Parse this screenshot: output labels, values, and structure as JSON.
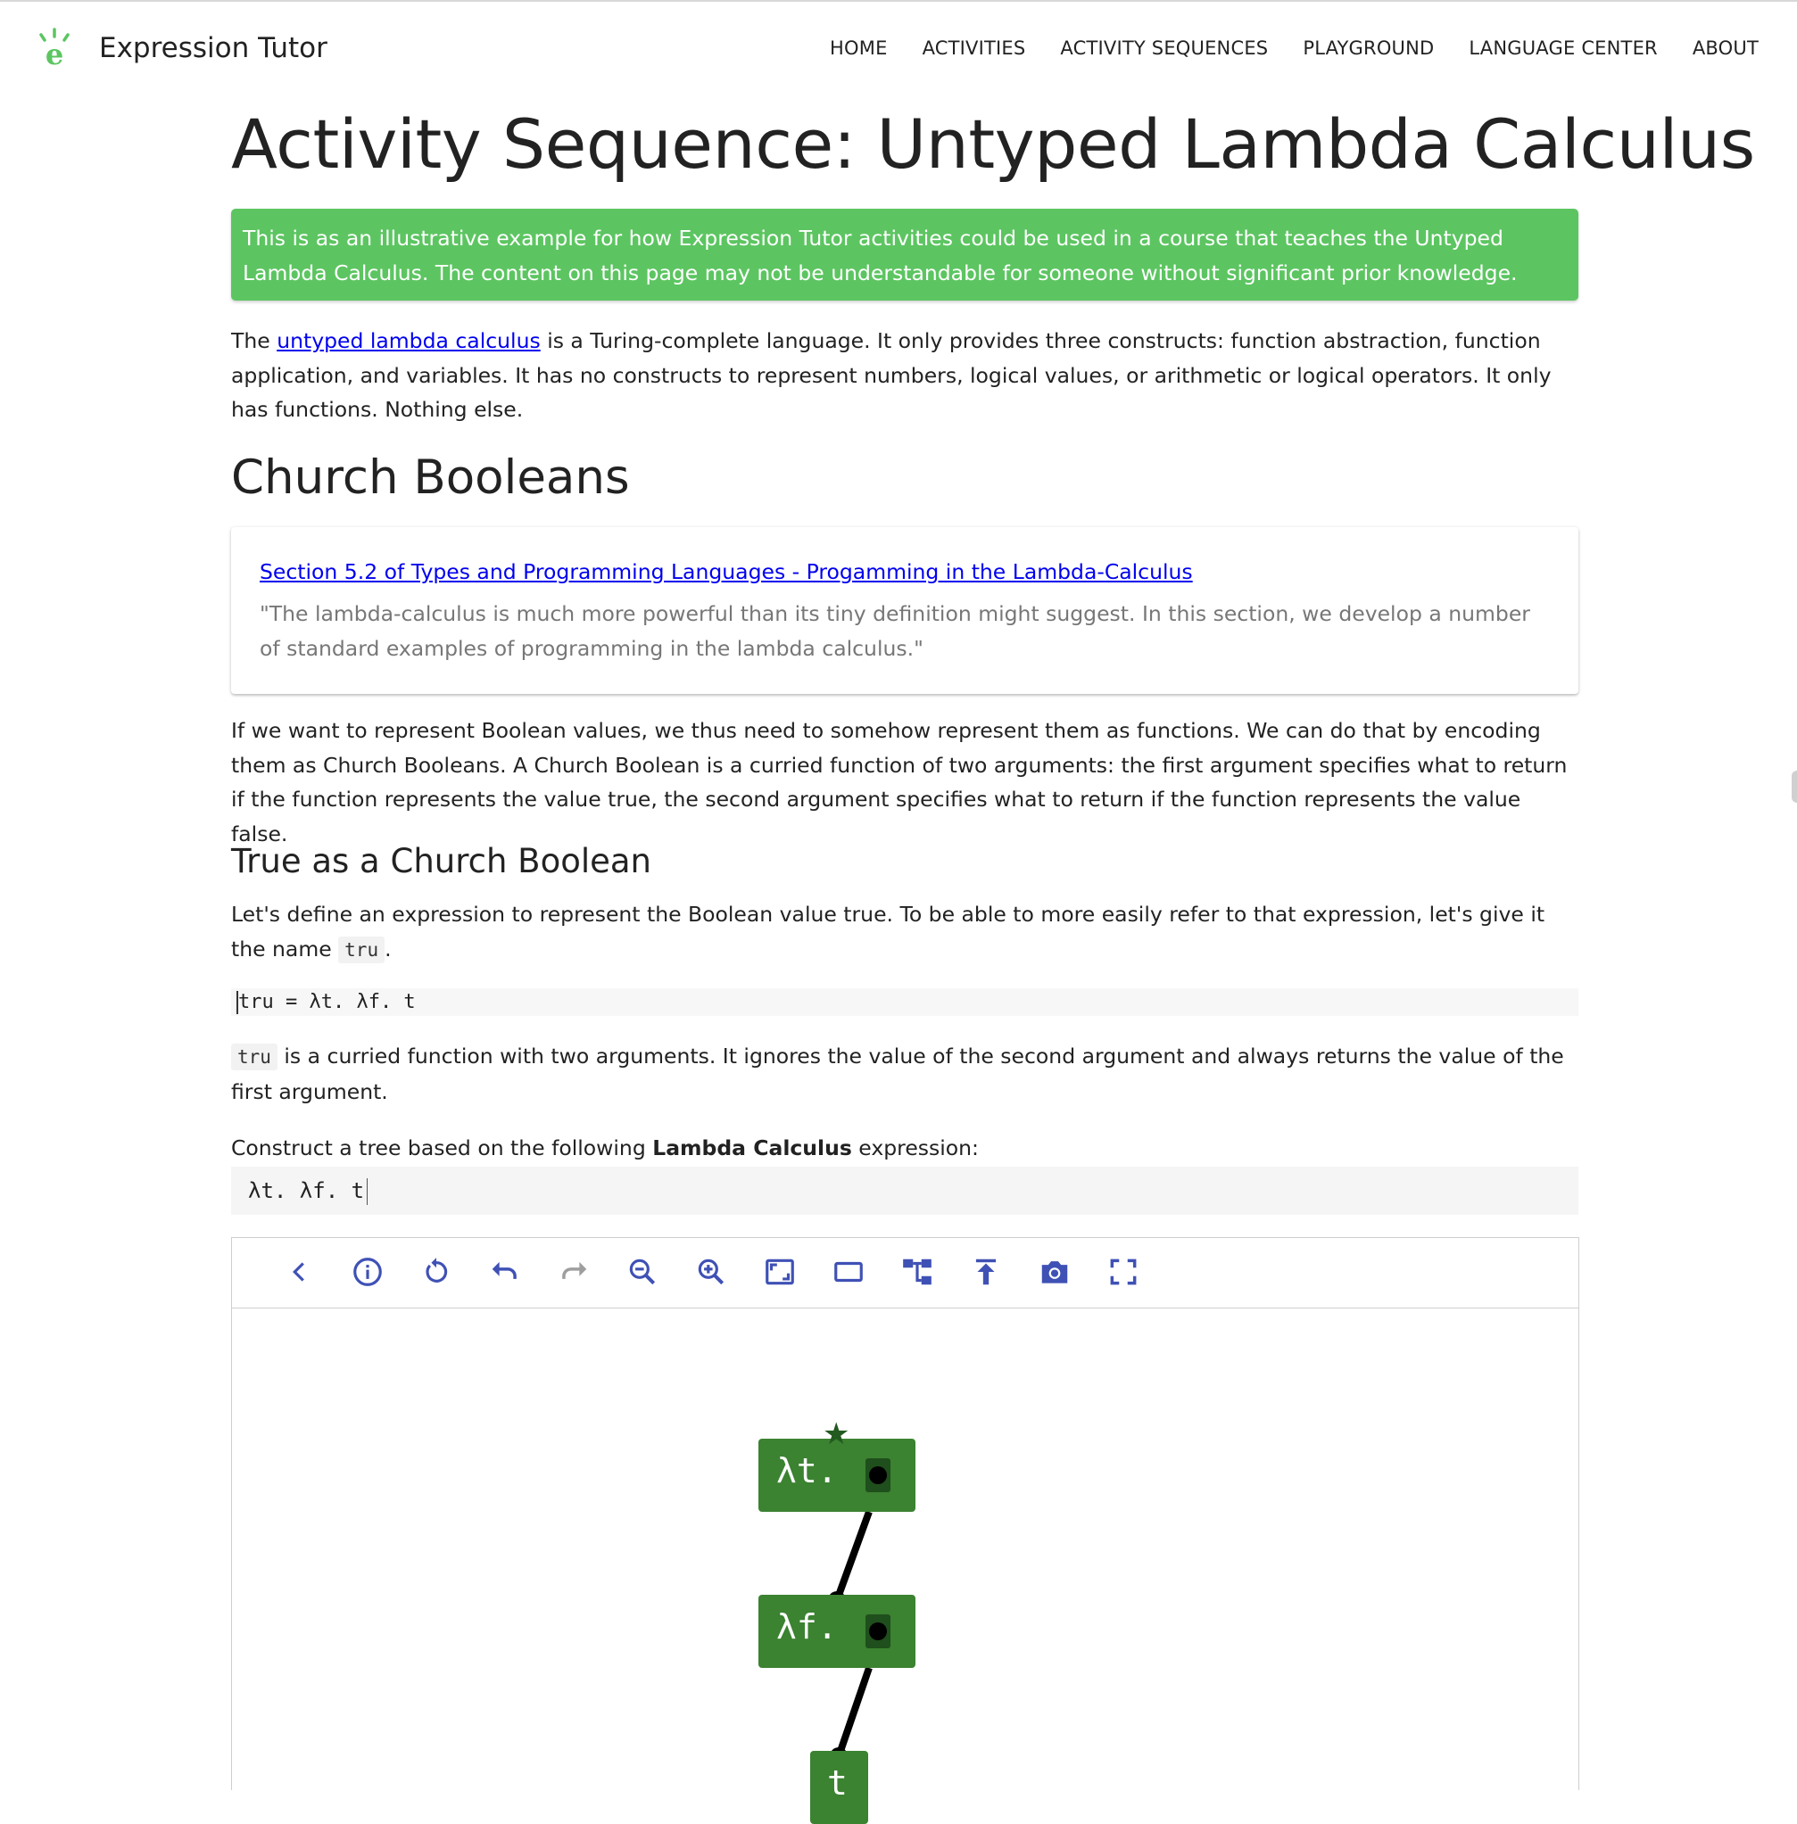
{
  "app": {
    "title": "Expression Tutor",
    "logo_letter": "e"
  },
  "nav": {
    "items": [
      "HOME",
      "ACTIVITIES",
      "ACTIVITY SEQUENCES",
      "PLAYGROUND",
      "LANGUAGE CENTER",
      "ABOUT"
    ]
  },
  "page": {
    "title": "Activity Sequence: Untyped Lambda Calculus"
  },
  "alert": {
    "text": "This is as an illustrative example for how Expression Tutor activities could be used in a course that teaches the Untyped Lambda Calculus. The content on this page may not be understandable for someone without significant prior knowledge."
  },
  "intro": {
    "prefix": "The ",
    "link": "untyped lambda calculus",
    "suffix": " is a Turing-complete language. It only provides three constructs: function abstraction, function application, and variables. It has no constructs to represent numbers, logical values, or arithmetic or logical operators. It only has functions. Nothing else."
  },
  "section": {
    "heading": "Church Booleans"
  },
  "reference": {
    "link": "Section 5.2 of Types and Programming Languages - Progamming in the Lambda-Calculus",
    "quote": "\"The lambda-calculus is much more powerful than its tiny definition might suggest. In this section, we develop a number of standard examples of programming in the lambda calculus.\""
  },
  "church_para": "If we want to represent Boolean values, we thus need to somehow represent them as functions. We can do that by encoding them as Church Booleans. A Church Boolean is a curried function of two arguments: the first argument specifies what to return if the function represents the value true, the second argument specifies what to return if the function represents the value false.",
  "subsection": {
    "heading": "True as a Church Boolean"
  },
  "define_para": {
    "text": "Let's define an expression to represent the Boolean value true. To be able to more easily refer to that expression, let's give it the name ",
    "code": "tru",
    "end": "."
  },
  "definition": {
    "code": "tru = λt. λf. t"
  },
  "tru_para": {
    "code": "tru",
    "text": " is a curried function with two arguments. It ignores the value of the second argument and always returns the value of the first argument."
  },
  "task": {
    "prefix": "Construct a tree based on the following ",
    "bold": "Lambda Calculus",
    "suffix": " expression:",
    "expression": "λt. λf. t"
  },
  "toolbar": {
    "icons": [
      "back-icon",
      "info-icon",
      "reset-icon",
      "undo-icon",
      "redo-icon",
      "zoom-out-icon",
      "zoom-in-icon",
      "fit-icon",
      "frame-icon",
      "layout-tree-icon",
      "upload-icon",
      "camera-icon",
      "fullscreen-icon"
    ],
    "icon_color": "#3f51b5",
    "disabled_color": "#9e9e9e"
  },
  "tree": {
    "node_color": "#3b8231",
    "nodes": [
      {
        "id": "n1",
        "label": "λt.",
        "has_hole": true,
        "root": true
      },
      {
        "id": "n2",
        "label": "λf.",
        "has_hole": true,
        "root": false
      },
      {
        "id": "n3",
        "label": "t",
        "has_hole": false,
        "root": false
      }
    ]
  }
}
